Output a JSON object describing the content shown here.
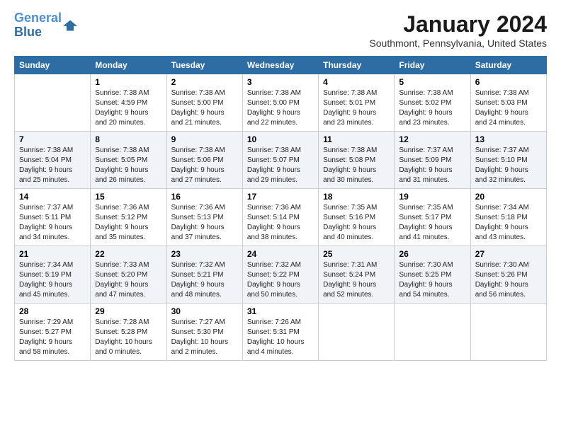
{
  "logo": {
    "line1": "General",
    "line2": "Blue"
  },
  "title": "January 2024",
  "location": "Southmont, Pennsylvania, United States",
  "days_header": [
    "Sunday",
    "Monday",
    "Tuesday",
    "Wednesday",
    "Thursday",
    "Friday",
    "Saturday"
  ],
  "weeks": [
    [
      {
        "num": "",
        "sunrise": "",
        "sunset": "",
        "daylight": ""
      },
      {
        "num": "1",
        "sunrise": "Sunrise: 7:38 AM",
        "sunset": "Sunset: 4:59 PM",
        "daylight": "Daylight: 9 hours and 20 minutes."
      },
      {
        "num": "2",
        "sunrise": "Sunrise: 7:38 AM",
        "sunset": "Sunset: 5:00 PM",
        "daylight": "Daylight: 9 hours and 21 minutes."
      },
      {
        "num": "3",
        "sunrise": "Sunrise: 7:38 AM",
        "sunset": "Sunset: 5:00 PM",
        "daylight": "Daylight: 9 hours and 22 minutes."
      },
      {
        "num": "4",
        "sunrise": "Sunrise: 7:38 AM",
        "sunset": "Sunset: 5:01 PM",
        "daylight": "Daylight: 9 hours and 23 minutes."
      },
      {
        "num": "5",
        "sunrise": "Sunrise: 7:38 AM",
        "sunset": "Sunset: 5:02 PM",
        "daylight": "Daylight: 9 hours and 23 minutes."
      },
      {
        "num": "6",
        "sunrise": "Sunrise: 7:38 AM",
        "sunset": "Sunset: 5:03 PM",
        "daylight": "Daylight: 9 hours and 24 minutes."
      }
    ],
    [
      {
        "num": "7",
        "sunrise": "Sunrise: 7:38 AM",
        "sunset": "Sunset: 5:04 PM",
        "daylight": "Daylight: 9 hours and 25 minutes."
      },
      {
        "num": "8",
        "sunrise": "Sunrise: 7:38 AM",
        "sunset": "Sunset: 5:05 PM",
        "daylight": "Daylight: 9 hours and 26 minutes."
      },
      {
        "num": "9",
        "sunrise": "Sunrise: 7:38 AM",
        "sunset": "Sunset: 5:06 PM",
        "daylight": "Daylight: 9 hours and 27 minutes."
      },
      {
        "num": "10",
        "sunrise": "Sunrise: 7:38 AM",
        "sunset": "Sunset: 5:07 PM",
        "daylight": "Daylight: 9 hours and 29 minutes."
      },
      {
        "num": "11",
        "sunrise": "Sunrise: 7:38 AM",
        "sunset": "Sunset: 5:08 PM",
        "daylight": "Daylight: 9 hours and 30 minutes."
      },
      {
        "num": "12",
        "sunrise": "Sunrise: 7:37 AM",
        "sunset": "Sunset: 5:09 PM",
        "daylight": "Daylight: 9 hours and 31 minutes."
      },
      {
        "num": "13",
        "sunrise": "Sunrise: 7:37 AM",
        "sunset": "Sunset: 5:10 PM",
        "daylight": "Daylight: 9 hours and 32 minutes."
      }
    ],
    [
      {
        "num": "14",
        "sunrise": "Sunrise: 7:37 AM",
        "sunset": "Sunset: 5:11 PM",
        "daylight": "Daylight: 9 hours and 34 minutes."
      },
      {
        "num": "15",
        "sunrise": "Sunrise: 7:36 AM",
        "sunset": "Sunset: 5:12 PM",
        "daylight": "Daylight: 9 hours and 35 minutes."
      },
      {
        "num": "16",
        "sunrise": "Sunrise: 7:36 AM",
        "sunset": "Sunset: 5:13 PM",
        "daylight": "Daylight: 9 hours and 37 minutes."
      },
      {
        "num": "17",
        "sunrise": "Sunrise: 7:36 AM",
        "sunset": "Sunset: 5:14 PM",
        "daylight": "Daylight: 9 hours and 38 minutes."
      },
      {
        "num": "18",
        "sunrise": "Sunrise: 7:35 AM",
        "sunset": "Sunset: 5:16 PM",
        "daylight": "Daylight: 9 hours and 40 minutes."
      },
      {
        "num": "19",
        "sunrise": "Sunrise: 7:35 AM",
        "sunset": "Sunset: 5:17 PM",
        "daylight": "Daylight: 9 hours and 41 minutes."
      },
      {
        "num": "20",
        "sunrise": "Sunrise: 7:34 AM",
        "sunset": "Sunset: 5:18 PM",
        "daylight": "Daylight: 9 hours and 43 minutes."
      }
    ],
    [
      {
        "num": "21",
        "sunrise": "Sunrise: 7:34 AM",
        "sunset": "Sunset: 5:19 PM",
        "daylight": "Daylight: 9 hours and 45 minutes."
      },
      {
        "num": "22",
        "sunrise": "Sunrise: 7:33 AM",
        "sunset": "Sunset: 5:20 PM",
        "daylight": "Daylight: 9 hours and 47 minutes."
      },
      {
        "num": "23",
        "sunrise": "Sunrise: 7:32 AM",
        "sunset": "Sunset: 5:21 PM",
        "daylight": "Daylight: 9 hours and 48 minutes."
      },
      {
        "num": "24",
        "sunrise": "Sunrise: 7:32 AM",
        "sunset": "Sunset: 5:22 PM",
        "daylight": "Daylight: 9 hours and 50 minutes."
      },
      {
        "num": "25",
        "sunrise": "Sunrise: 7:31 AM",
        "sunset": "Sunset: 5:24 PM",
        "daylight": "Daylight: 9 hours and 52 minutes."
      },
      {
        "num": "26",
        "sunrise": "Sunrise: 7:30 AM",
        "sunset": "Sunset: 5:25 PM",
        "daylight": "Daylight: 9 hours and 54 minutes."
      },
      {
        "num": "27",
        "sunrise": "Sunrise: 7:30 AM",
        "sunset": "Sunset: 5:26 PM",
        "daylight": "Daylight: 9 hours and 56 minutes."
      }
    ],
    [
      {
        "num": "28",
        "sunrise": "Sunrise: 7:29 AM",
        "sunset": "Sunset: 5:27 PM",
        "daylight": "Daylight: 9 hours and 58 minutes."
      },
      {
        "num": "29",
        "sunrise": "Sunrise: 7:28 AM",
        "sunset": "Sunset: 5:28 PM",
        "daylight": "Daylight: 10 hours and 0 minutes."
      },
      {
        "num": "30",
        "sunrise": "Sunrise: 7:27 AM",
        "sunset": "Sunset: 5:30 PM",
        "daylight": "Daylight: 10 hours and 2 minutes."
      },
      {
        "num": "31",
        "sunrise": "Sunrise: 7:26 AM",
        "sunset": "Sunset: 5:31 PM",
        "daylight": "Daylight: 10 hours and 4 minutes."
      },
      {
        "num": "",
        "sunrise": "",
        "sunset": "",
        "daylight": ""
      },
      {
        "num": "",
        "sunrise": "",
        "sunset": "",
        "daylight": ""
      },
      {
        "num": "",
        "sunrise": "",
        "sunset": "",
        "daylight": ""
      }
    ]
  ]
}
